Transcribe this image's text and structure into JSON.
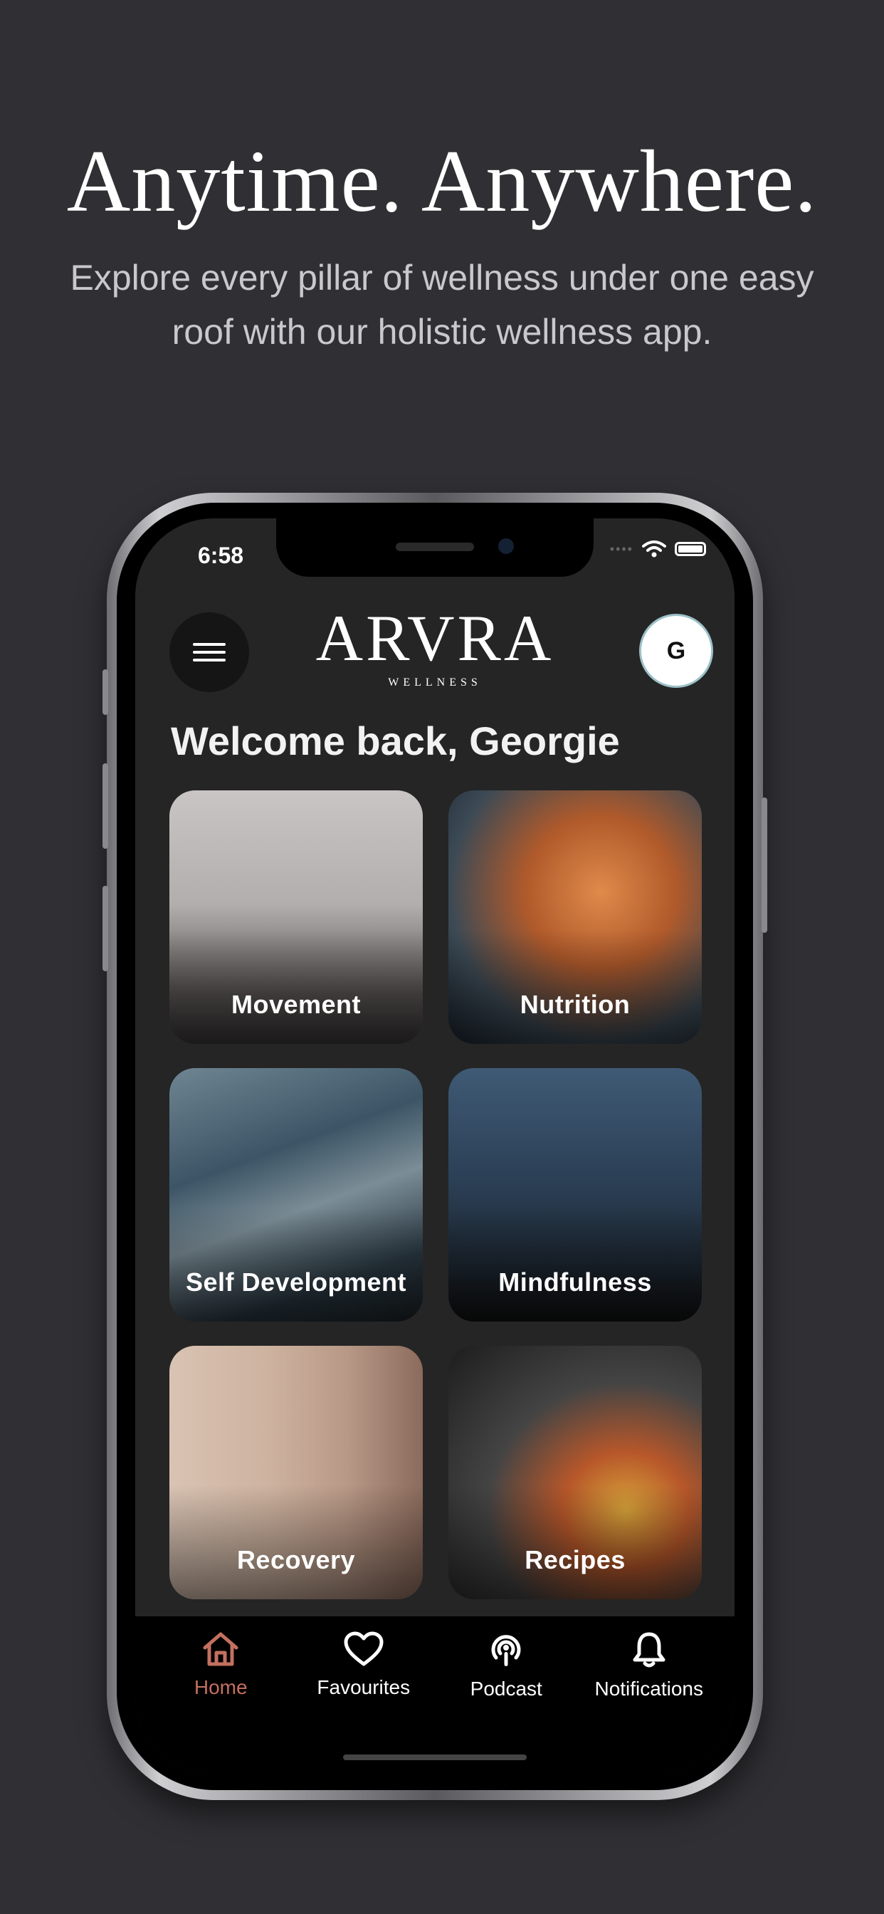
{
  "hero": {
    "title": "Anytime. Anywhere.",
    "subtitle": "Explore every pillar of wellness under one easy roof with our holistic wellness app."
  },
  "status_bar": {
    "time": "6:58"
  },
  "header": {
    "logo": "ARVRA",
    "logo_sub": "WELLNESS",
    "avatar_initial": "G",
    "menu_icon": "hamburger-menu-icon"
  },
  "welcome": "Welcome back, Georgie",
  "categories": [
    {
      "label": "Movement"
    },
    {
      "label": "Nutrition"
    },
    {
      "label": "Self Development"
    },
    {
      "label": "Mindfulness"
    },
    {
      "label": "Recovery"
    },
    {
      "label": "Recipes"
    }
  ],
  "tabs": [
    {
      "label": "Home",
      "icon": "home-icon",
      "active": true
    },
    {
      "label": "Favourites",
      "icon": "heart-icon",
      "active": false
    },
    {
      "label": "Podcast",
      "icon": "podcast-icon",
      "active": false
    },
    {
      "label": "Notifications",
      "icon": "bell-icon",
      "active": false
    }
  ],
  "colors": {
    "background": "#303034",
    "screen": "#252525",
    "accent": "#c4705f",
    "tabbar": "#000000"
  }
}
